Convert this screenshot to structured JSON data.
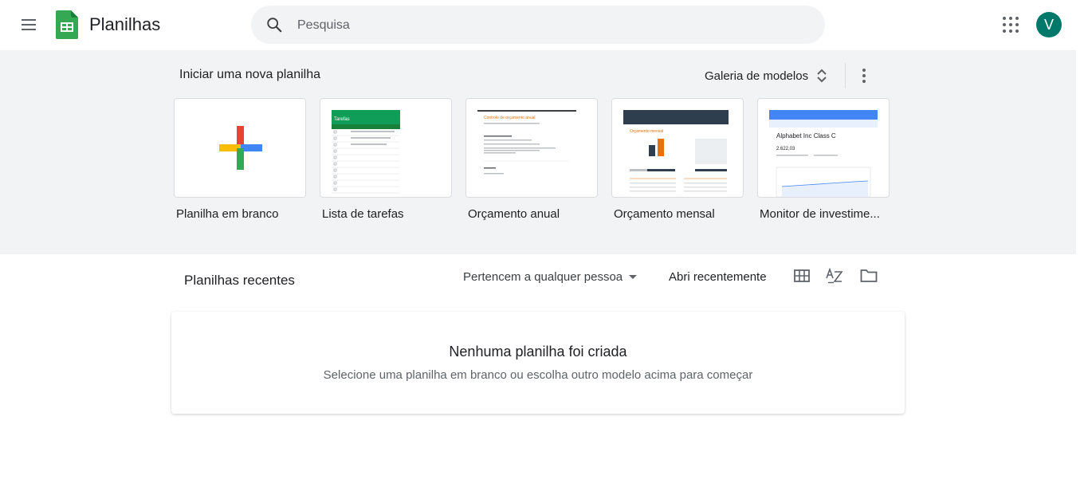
{
  "app": {
    "name": "Planilhas"
  },
  "search": {
    "placeholder": "Pesquisa"
  },
  "account": {
    "initial": "V",
    "color": "#00796b"
  },
  "new_sheet": {
    "title": "Iniciar uma nova planilha",
    "gallery_label": "Galeria de modelos",
    "templates": [
      {
        "label": "Planilha em branco"
      },
      {
        "label": "Lista de tarefas",
        "thumb_header": "Tarefas"
      },
      {
        "label": "Orçamento anual",
        "thumb_header": "Controle de orçamento anual"
      },
      {
        "label": "Orçamento mensal",
        "thumb_header": "Orçamento mensal"
      },
      {
        "label": "Monitor de investime...",
        "thumb_header": "Alphabet Inc Class C",
        "thumb_value": "2.622,03"
      }
    ]
  },
  "recent": {
    "title": "Planilhas recentes",
    "owner_filter": "Pertencem a qualquer pessoa",
    "sort_label": "Abri recentemente"
  },
  "empty_state": {
    "title": "Nenhuma planilha foi criada",
    "subtitle": "Selecione uma planilha em branco ou escolha outro modelo acima para começar"
  },
  "icons": [
    "menu-icon",
    "sheets-logo-icon",
    "search-icon",
    "apps-grid-icon",
    "unfold-icon",
    "more-vert-icon",
    "plus-icon",
    "dropdown-arrow-icon",
    "grid-view-icon",
    "sort-az-icon",
    "folder-icon"
  ]
}
